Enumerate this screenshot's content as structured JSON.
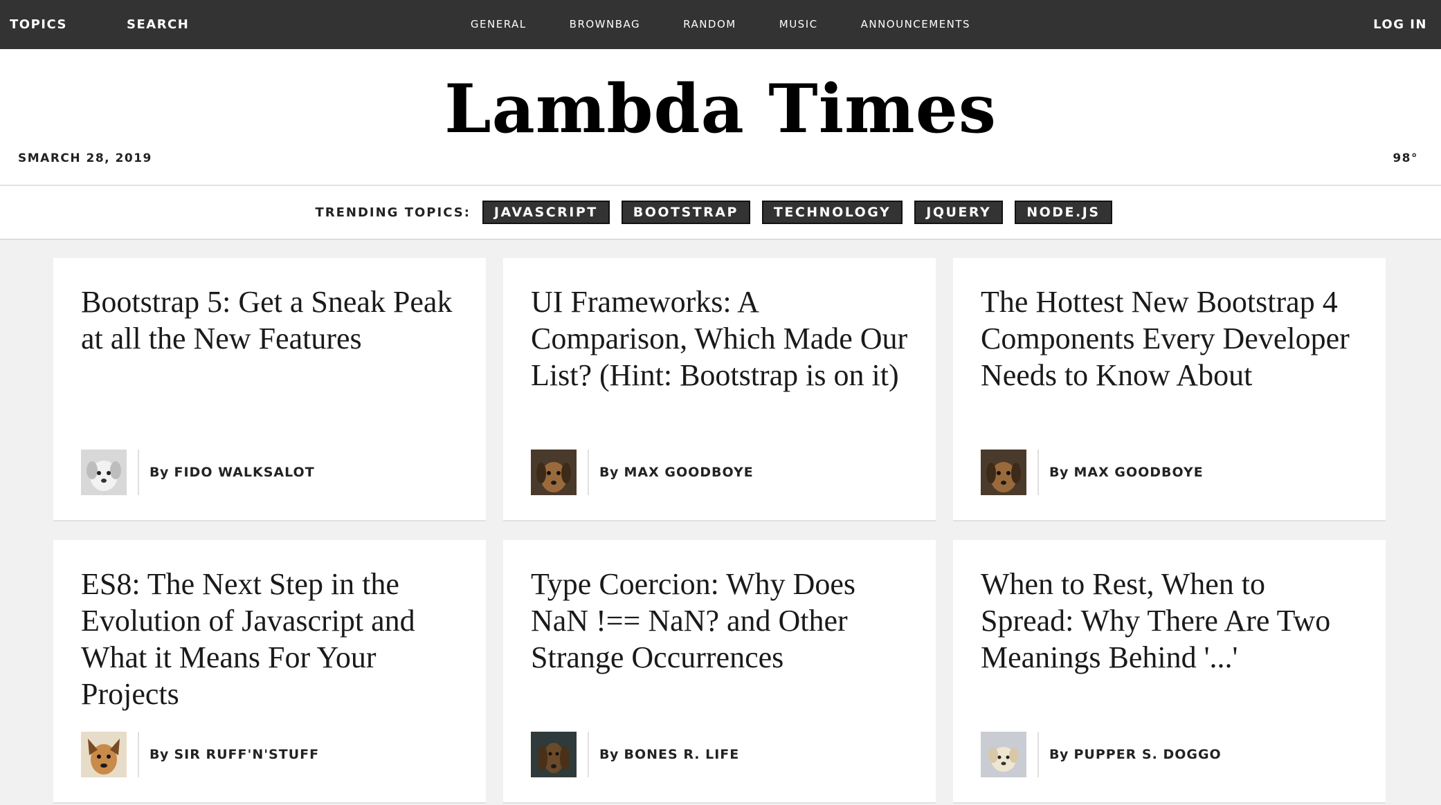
{
  "nav": {
    "topics": "TOPICS",
    "search": "SEARCH",
    "tabs": [
      "GENERAL",
      "BROWNBAG",
      "RANDOM",
      "MUSIC",
      "ANNOUNCEMENTS"
    ],
    "login": "LOG IN"
  },
  "masthead": {
    "title": "Lambda Times",
    "date": "SMARCH 28, 2019",
    "temp": "98°"
  },
  "trending": {
    "label": "TRENDING TOPICS:",
    "tags": [
      "JAVASCRIPT",
      "BOOTSTRAP",
      "TECHNOLOGY",
      "JQUERY",
      "NODE.JS"
    ]
  },
  "cards": [
    {
      "headline": "Bootstrap 5: Get a Sneak Peak at all the New Features",
      "by": "By",
      "author": "FIDO WALKSALOT",
      "avatar_icon": "dog-avatar-icon"
    },
    {
      "headline": "UI Frameworks: A Comparison, Which Made Our List? (Hint: Bootstrap is on it)",
      "by": "By",
      "author": "MAX GOODBOYE",
      "avatar_icon": "dog-avatar-icon"
    },
    {
      "headline": "The Hottest New Bootstrap 4 Components Every Developer Needs to Know About",
      "by": "By",
      "author": "MAX GOODBOYE",
      "avatar_icon": "dog-avatar-icon"
    },
    {
      "headline": "ES8: The Next Step in the Evolution of Javascript and What it Means For Your Projects",
      "by": "By",
      "author": "SIR RUFF'N'STUFF",
      "avatar_icon": "dog-avatar-icon"
    },
    {
      "headline": "Type Coercion: Why Does NaN !== NaN? and Other Strange Occurrences",
      "by": "By",
      "author": "BONES R. LIFE",
      "avatar_icon": "dog-avatar-icon"
    },
    {
      "headline": "When to Rest, When to Spread: Why There Are Two Meanings Behind '...'",
      "by": "By",
      "author": "PUPPER S. DOGGO",
      "avatar_icon": "dog-avatar-icon"
    }
  ],
  "colors": {
    "nav_bg": "#333333",
    "tag_bg": "#333333",
    "page_bg": "#f1f1f1",
    "card_bg": "#ffffff"
  }
}
